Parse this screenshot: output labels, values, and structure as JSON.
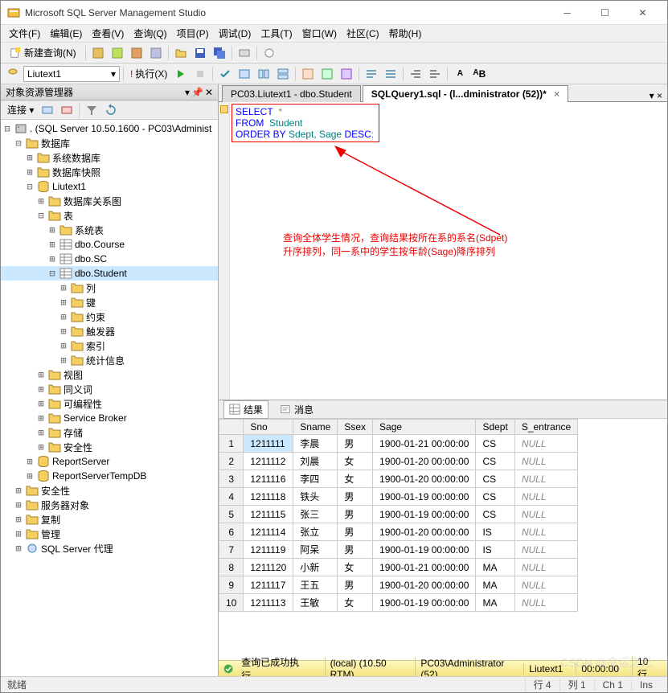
{
  "window": {
    "title": "Microsoft SQL Server Management Studio"
  },
  "menu": [
    "文件(F)",
    "编辑(E)",
    "查看(V)",
    "查询(Q)",
    "项目(P)",
    "调试(D)",
    "工具(T)",
    "窗口(W)",
    "社区(C)",
    "帮助(H)"
  ],
  "toolbar": {
    "new_query": "新建查询(N)",
    "execute": "执行(X)",
    "db_selected": "Liutext1"
  },
  "sidebar": {
    "title": "对象资源管理器",
    "connect_label": "连接 ▾",
    "root": ". (SQL Server 10.50.1600 - PC03\\Administ",
    "nodes": {
      "databases": "数据库",
      "sys_db": "系统数据库",
      "db_snap": "数据库快照",
      "liutext1": "Liutext1",
      "db_diag": "数据库关系图",
      "tables": "表",
      "sys_tables": "系统表",
      "dbo_course": "dbo.Course",
      "dbo_sc": "dbo.SC",
      "dbo_student": "dbo.Student",
      "columns": "列",
      "keys": "键",
      "constraints": "约束",
      "triggers": "触发器",
      "indexes": "索引",
      "stats": "统计信息",
      "views": "视图",
      "synonyms": "同义词",
      "programmability": "可编程性",
      "service_broker": "Service Broker",
      "storage": "存储",
      "security_db": "安全性",
      "report_server": "ReportServer",
      "report_server_temp": "ReportServerTempDB",
      "security": "安全性",
      "server_objects": "服务器对象",
      "replication": "复制",
      "management": "管理",
      "sql_agent": "SQL Server 代理"
    }
  },
  "tabs": [
    {
      "label": "PC03.Liutext1 - dbo.Student",
      "active": false
    },
    {
      "label": "SQLQuery1.sql - (l...dministrator (52))*",
      "active": true
    }
  ],
  "sql": {
    "select": "SELECT",
    "star": "*",
    "from": "FROM",
    "table": "Student",
    "orderby": "ORDER BY",
    "cols": "Sdept, Sage",
    "desc": "DESC",
    "semi": ";"
  },
  "annotation": {
    "line1": "查询全体学生情况，查询结果按所在系的系名(Sdpet)",
    "line2": "升序排列，同一系中的学生按年龄(Sage)降序排列"
  },
  "results": {
    "tab_results": "结果",
    "tab_messages": "消息",
    "columns": [
      "Sno",
      "Sname",
      "Ssex",
      "Sage",
      "Sdept",
      "S_entrance"
    ],
    "rows": [
      [
        "1211111",
        "李晨",
        "男",
        "1900-01-21 00:00:00",
        "CS",
        "NULL"
      ],
      [
        "1211112",
        "刘晨",
        "女",
        "1900-01-20 00:00:00",
        "CS",
        "NULL"
      ],
      [
        "1211116",
        "李四",
        "女",
        "1900-01-20 00:00:00",
        "CS",
        "NULL"
      ],
      [
        "1211118",
        "铁头",
        "男",
        "1900-01-19 00:00:00",
        "CS",
        "NULL"
      ],
      [
        "1211115",
        "张三",
        "男",
        "1900-01-19 00:00:00",
        "CS",
        "NULL"
      ],
      [
        "1211114",
        "张立",
        "男",
        "1900-01-20 00:00:00",
        "IS",
        "NULL"
      ],
      [
        "1211119",
        "阿呆",
        "男",
        "1900-01-19 00:00:00",
        "IS",
        "NULL"
      ],
      [
        "1211120",
        "小新",
        "女",
        "1900-01-21 00:00:00",
        "MA",
        "NULL"
      ],
      [
        "1211117",
        "王五",
        "男",
        "1900-01-20 00:00:00",
        "MA",
        "NULL"
      ],
      [
        "1211113",
        "王敏",
        "女",
        "1900-01-19 00:00:00",
        "MA",
        "NULL"
      ]
    ]
  },
  "query_status": {
    "success": "查询已成功执行。",
    "server": "(local) (10.50 RTM)",
    "user": "PC03\\Administrator (52)",
    "db": "Liutext1",
    "time": "00:00:00",
    "rows": "10 行"
  },
  "statusbar": {
    "ready": "就绪",
    "line": "行 4",
    "col": "列 1",
    "ch": "Ch 1",
    "ins": "Ins"
  },
  "watermark": "CSDN @命运之光"
}
